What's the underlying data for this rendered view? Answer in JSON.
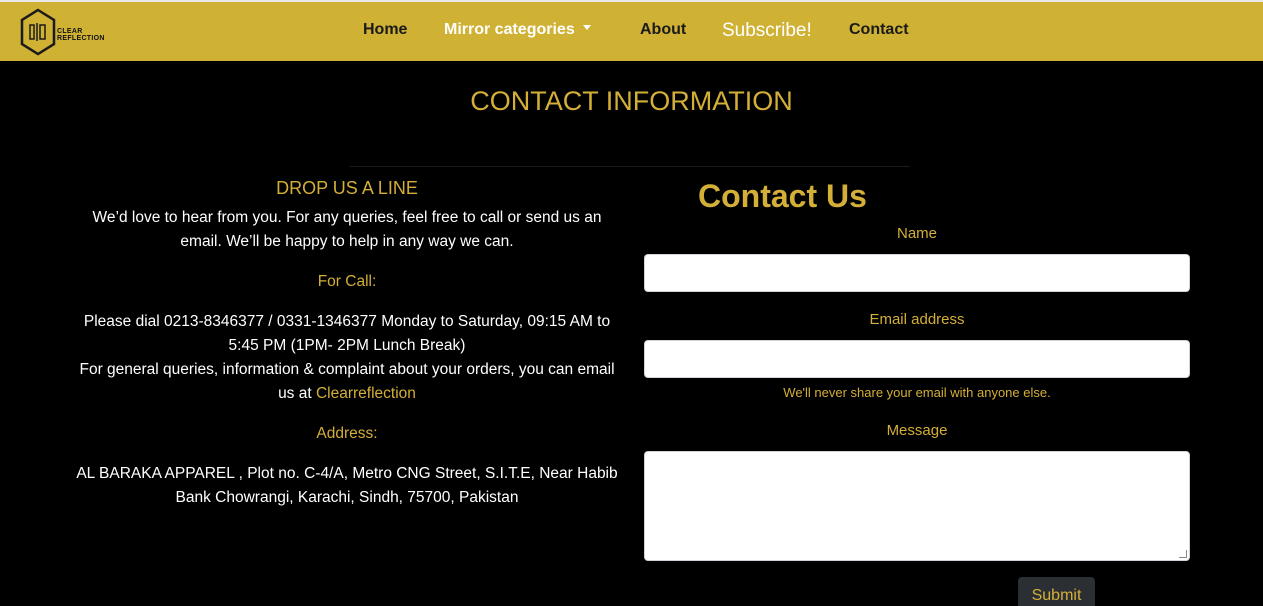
{
  "brand": {
    "logo_text_line1": "CLEAR",
    "logo_text_line2": "REFLECTION"
  },
  "nav": {
    "home": "Home",
    "mirror_categories": "Mirror categories",
    "about": "About",
    "subscribe": "Subscribe!",
    "contact": "Contact"
  },
  "page": {
    "title": "CONTACT INFORMATION"
  },
  "info": {
    "heading": "DROP US A LINE",
    "intro": "We’d love to hear from you. For any queries, feel free to call or send us an email. We’ll be happy to help in any way we can.",
    "call_label": "For Call:",
    "call_text": "Please dial 0213-8346377 / 0331-1346377 Monday to Saturday, 09:15 AM to 5:45 PM (1PM- 2PM Lunch Break)",
    "email_text": "For general queries, information & complaint about your orders, you can email us at",
    "email_link": "Clearreflection",
    "address_label": "Address:",
    "address_text": "AL BARAKA APPAREL , Plot no. C-4/A, Metro CNG Street, S.I.T.E, Near Habib Bank Chowrangi, Karachi, Sindh, 75700, Pakistan"
  },
  "form": {
    "title": "Contact Us",
    "name_label": "Name",
    "name_value": "",
    "email_label": "Email address",
    "email_value": "",
    "email_help": "We'll never share your email with anyone else.",
    "message_label": "Message",
    "message_value": "",
    "submit_label": "Submit"
  },
  "colors": {
    "navbar_bg": "#cfb134",
    "accent_gold": "#d4af37",
    "page_bg": "#000000",
    "button_bg": "#2b2f33"
  },
  "icons": {
    "logo": "hexagon-logo-icon",
    "dropdown": "caret-down-icon"
  }
}
